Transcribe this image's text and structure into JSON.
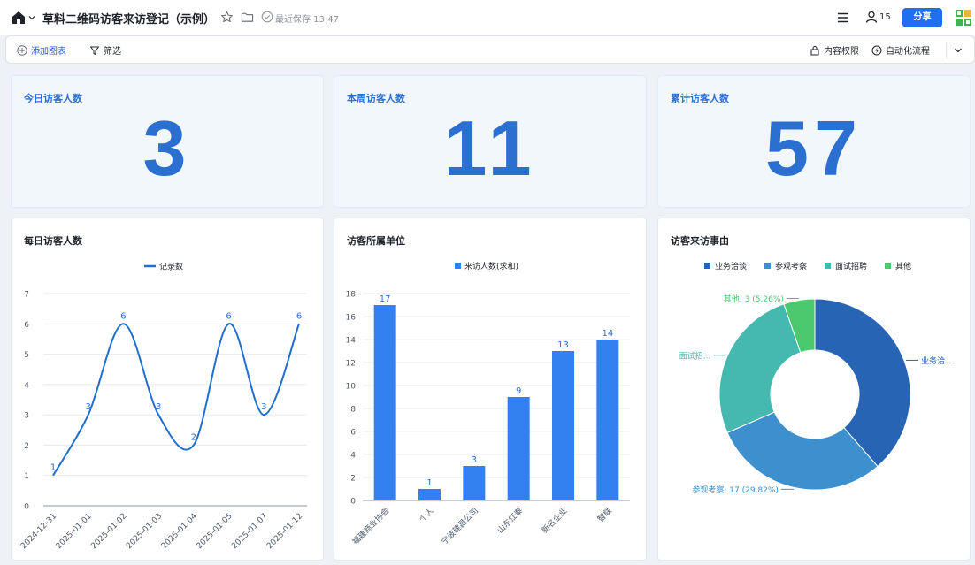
{
  "header": {
    "title": "草料二维码访客来访登记（示例）",
    "save_status": "最近保存 13:47",
    "user_count": "15",
    "share_label": "分享"
  },
  "toolbar": {
    "add_chart": "添加图表",
    "filter": "筛选",
    "permissions": "内容权限",
    "automation": "自动化流程"
  },
  "kpis": [
    {
      "label": "今日访客人数",
      "value": "3"
    },
    {
      "label": "本周访客人数",
      "value": "11"
    },
    {
      "label": "累计访客人数",
      "value": "57"
    }
  ],
  "colors": {
    "accent": "#1f6ff0",
    "kpi_text": "#2b6fd0",
    "bar": "#3380f0",
    "line": "#1f6fce"
  },
  "chart_data": [
    {
      "type": "line",
      "title": "每日访客人数",
      "series": [
        {
          "name": "记录数",
          "values": [
            1,
            3,
            6,
            3,
            2,
            6,
            3,
            6
          ]
        }
      ],
      "categories": [
        "2024-12-31",
        "2025-01-01",
        "2025-01-02",
        "2025-01-03",
        "2025-01-04",
        "2025-01-05",
        "2025-01-07",
        "2025-01-12"
      ],
      "ylim": [
        0,
        7
      ],
      "yticks": [
        0,
        1,
        2,
        3,
        4,
        5,
        6,
        7
      ],
      "smooth": true,
      "grid": true,
      "legend": "top-center"
    },
    {
      "type": "bar",
      "title": "访客所属单位",
      "series": [
        {
          "name": "来访人数(求和)",
          "values": [
            17,
            1,
            3,
            9,
            13,
            14
          ]
        }
      ],
      "categories": [
        "福建商业协会",
        "个人",
        "宁波建昌公司",
        "山东红泰",
        "新名企业",
        "智联"
      ],
      "ylim": [
        0,
        18
      ],
      "yticks": [
        0,
        2,
        4,
        6,
        8,
        10,
        12,
        14,
        16,
        18
      ],
      "grid": true,
      "legend": "top-center"
    },
    {
      "type": "pie",
      "title": "访客来访事由",
      "donut": true,
      "legend": "top-center",
      "slices": [
        {
          "name": "业务洽谈",
          "value": 22,
          "color": "#2764b4",
          "label": "业务洽..."
        },
        {
          "name": "参观考察",
          "value": 17,
          "color": "#3d8fcd",
          "label": "参观考察: 17 (29.82%)"
        },
        {
          "name": "面试招聘",
          "value": 15,
          "color": "#45b8b0",
          "label": "面试招..."
        },
        {
          "name": "其他",
          "value": 3,
          "color": "#4cc96f",
          "label": "其他: 3 (5.26%)"
        }
      ]
    }
  ]
}
